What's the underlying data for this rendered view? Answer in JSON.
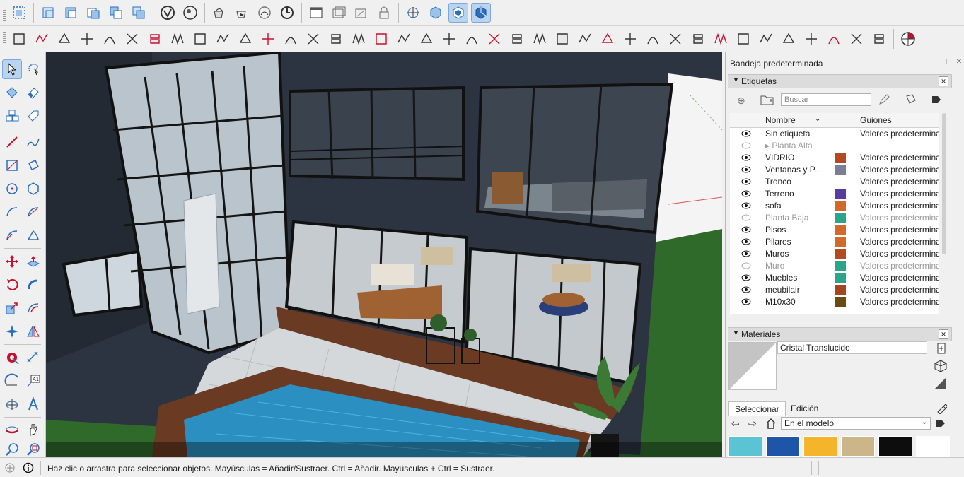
{
  "toolbar": {
    "row1_icons": [
      "select-box-icon",
      "view-iso-icon",
      "view-top-icon",
      "view-front-icon",
      "view-right-icon",
      "view-back-icon",
      "sketchup-logo-icon",
      "component-icon",
      "paint-bucket-icon",
      "push-pull-icon",
      "orbit-icon",
      "undo-history-icon",
      "section-plane-icon",
      "display-section-icon",
      "section-fill-icon",
      "lock-icon",
      "axes-icon",
      "styles-icon",
      "pan-view-icon",
      "walk-icon"
    ],
    "row2_icon_count": 39
  },
  "viewport": {
    "scene": "3d-house-model",
    "sky": "#f4f4f4",
    "wall_color": "#2b3440",
    "grass_color": "#2f6a2a",
    "pool_color": "#2b8fc1",
    "deck_color": "#6b3a23"
  },
  "tray": {
    "title": "Bandeja predeterminada",
    "tags_panel": {
      "title": "Etiquetas",
      "search_placeholder": "Buscar",
      "columns": {
        "name": "Nombre",
        "dashes": "Guiones"
      },
      "rows": [
        {
          "name": "Sin etiqueta",
          "color": "",
          "dashes": "Valores predetermina",
          "visible": true
        },
        {
          "name": "▸  Planta Alta",
          "color": "",
          "dashes": "",
          "visible": false
        },
        {
          "name": "VIDRIO",
          "color": "#b24a22",
          "dashes": "Valores predetermina",
          "visible": true
        },
        {
          "name": "Ventanas y P...",
          "color": "#7a7f96",
          "dashes": "Valores predetermina",
          "visible": true
        },
        {
          "name": "Tronco",
          "color": "#ffffff",
          "dashes": "Valores predetermina",
          "visible": true
        },
        {
          "name": "Terreno",
          "color": "#5a3c9a",
          "dashes": "Valores predetermina",
          "visible": true
        },
        {
          "name": "sofa",
          "color": "#d2692a",
          "dashes": "Valores predetermina",
          "visible": true
        },
        {
          "name": "Planta Baja",
          "color": "#2aa58c",
          "dashes": "Valores predetermina",
          "visible": false
        },
        {
          "name": "Pisos",
          "color": "#d2692a",
          "dashes": "Valores predetermina",
          "visible": true
        },
        {
          "name": "Pilares",
          "color": "#d2692a",
          "dashes": "Valores predetermina",
          "visible": true
        },
        {
          "name": "Muros",
          "color": "#b24a22",
          "dashes": "Valores predetermina",
          "visible": true
        },
        {
          "name": "Muro",
          "color": "#2aa58c",
          "dashes": "Valores predetermina",
          "visible": false
        },
        {
          "name": "Muebles",
          "color": "#2aa58c",
          "dashes": "Valores predetermina",
          "visible": true
        },
        {
          "name": "meubilair",
          "color": "#a3451f",
          "dashes": "Valores predetermina",
          "visible": true
        },
        {
          "name": "M10x30",
          "color": "#6b4a12",
          "dashes": "Valores predetermina",
          "visible": true
        }
      ]
    },
    "materials_panel": {
      "title": "Materiales",
      "current_material": "Cristal Translucido",
      "tabs": [
        "Seleccionar",
        "Edición"
      ],
      "collection": "En el modelo",
      "swatches": [
        "#5bc4d4",
        "#1f55a8",
        "#f5b52a",
        "#cdb58a",
        "#0d0d0d",
        "#ffffff"
      ]
    }
  },
  "status": {
    "message": "Haz clic o arrastra para seleccionar objetos. Mayúsculas = Añadir/Sustraer. Ctrl = Añadir. Mayúsculas + Ctrl = Sustraer."
  }
}
